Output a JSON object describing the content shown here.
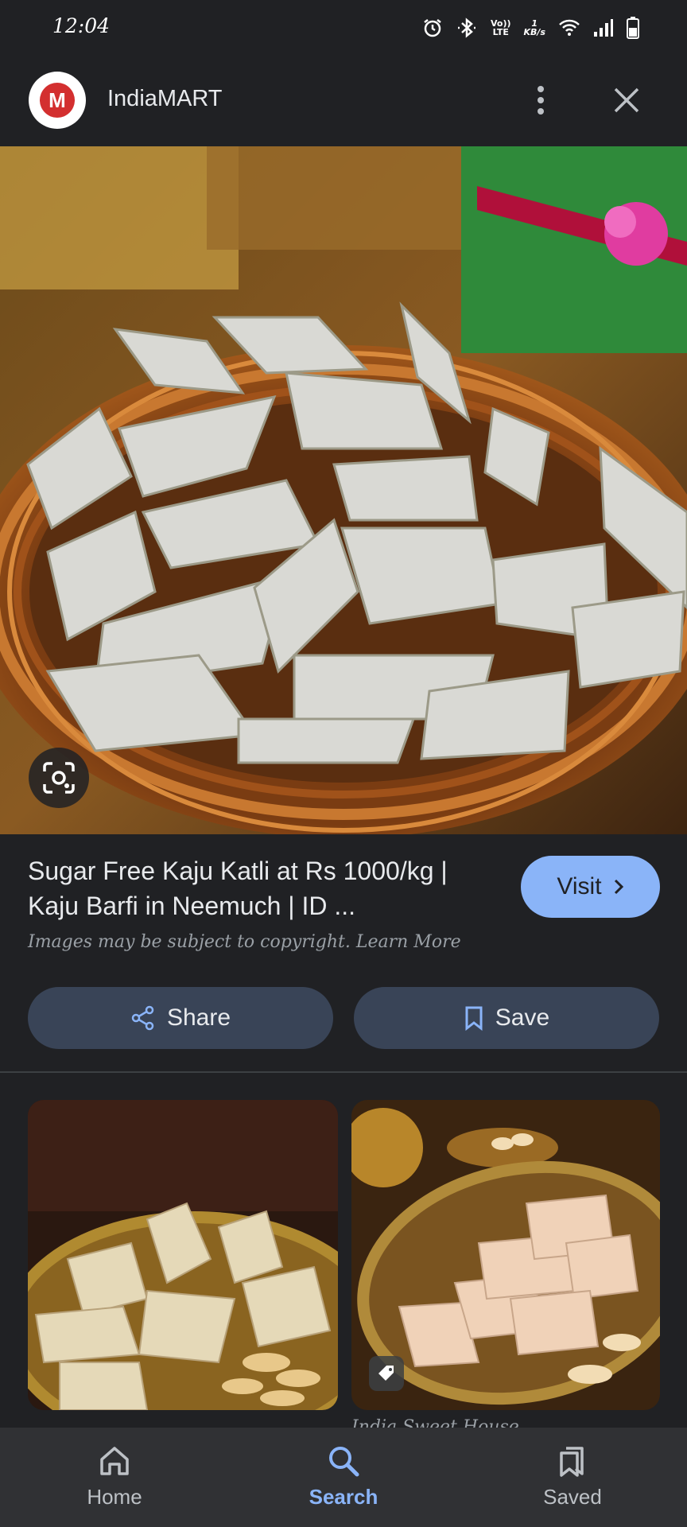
{
  "status_bar": {
    "time": "12:04",
    "net_top": "Vo))",
    "net_bottom": "LTE",
    "speed_top": "1",
    "speed_bottom": "KB/s"
  },
  "header": {
    "site_name": "IndiaMART",
    "logo_icon": "indiamart-logo",
    "brand_color": "#d32f2f"
  },
  "result": {
    "title": "Sugar Free Kaju Katli at Rs 1000/kg | Kaju Barfi in Neemuch | ID ...",
    "copyright": "Images may be subject to copyright. Learn More",
    "visit_label": "Visit",
    "share_label": "Share",
    "save_label": "Save"
  },
  "related": {
    "caption": "India Sweet House..."
  },
  "nav": {
    "items": [
      {
        "label": "Home",
        "icon": "home-icon",
        "active": false
      },
      {
        "label": "Search",
        "icon": "search-icon",
        "active": true
      },
      {
        "label": "Saved",
        "icon": "bookmark-icon",
        "active": false
      }
    ]
  },
  "colors": {
    "background": "#202124",
    "accent": "#8ab4f8",
    "button_bg": "#394457"
  }
}
